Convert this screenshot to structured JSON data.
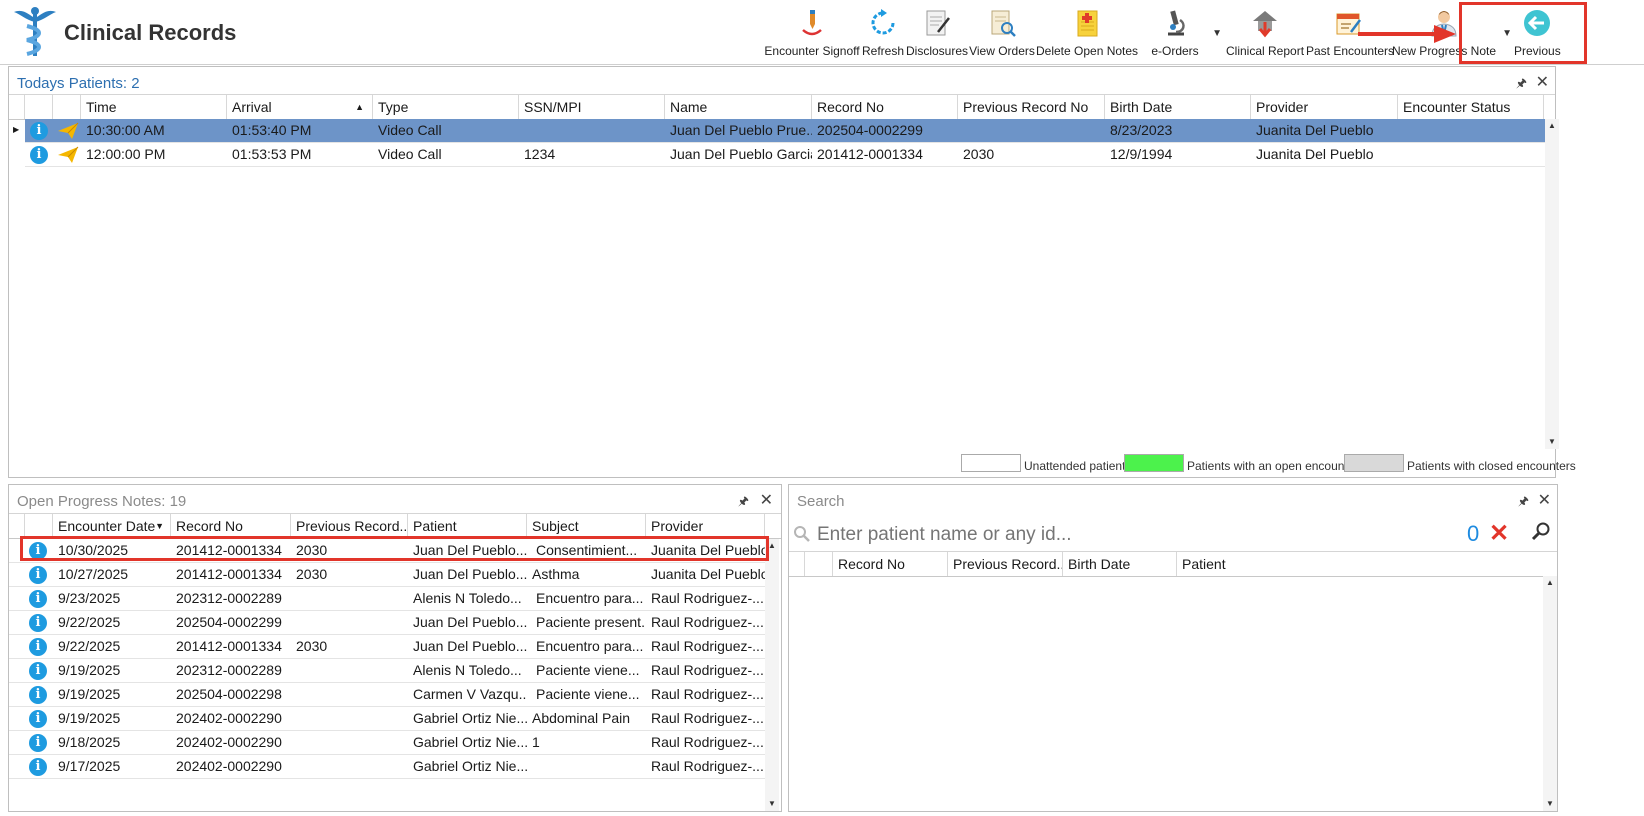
{
  "app": {
    "title": "Clinical Records"
  },
  "toolbar": {
    "encounter_signoff": "Encounter Signoff",
    "refresh": "Refresh",
    "disclosures": "Disclosures",
    "view_orders": "View Orders",
    "delete_open_notes": "Delete Open Notes",
    "e_orders": "e-Orders",
    "clinical_report": "Clinical Report",
    "past_encounters": "Past Encounters",
    "new_progress_note": "New Progress Note",
    "previous": "Previous"
  },
  "todays_patients": {
    "title": "Todays Patients:",
    "count": "2",
    "columns": [
      "Time",
      "Arrival",
      "Type",
      "SSN/MPI",
      "Name",
      "Record No",
      "Previous Record No",
      "Birth Date",
      "Provider",
      "Encounter Status"
    ],
    "rows": [
      {
        "time": "10:30:00 AM",
        "arrival": "01:53:40 PM",
        "type": "Video Call",
        "ssn": "",
        "name": "Juan Del Pueblo Prue...",
        "record_no": "202504-0002299",
        "prev_record_no": "",
        "birth_date": "8/23/2023",
        "provider": "Juanita Del Pueblo",
        "status": ""
      },
      {
        "time": "12:00:00 PM",
        "arrival": "01:53:53 PM",
        "type": "Video Call",
        "ssn": "1234",
        "name": "Juan Del Pueblo Garcia",
        "record_no": "201412-0001334",
        "prev_record_no": "2030",
        "birth_date": "12/9/1994",
        "provider": "Juanita Del Pueblo",
        "status": ""
      }
    ]
  },
  "legend": {
    "unattended": "Unattended patients",
    "open": "Patients with an open encounter",
    "closed": "Patients with closed encounters",
    "colors": {
      "unattended": "#ffffff",
      "open": "#4cf24c",
      "closed": "#d9d9d9"
    }
  },
  "open_notes": {
    "title": "Open Progress Notes:",
    "count": "19",
    "columns": [
      "Encounter Date",
      "Record No",
      "Previous Record...",
      "Patient",
      "Subject",
      "Provider"
    ],
    "rows": [
      {
        "date": "10/30/2025",
        "record_no": "201412-0001334",
        "prev": "2030",
        "patient": "Juan Del Pueblo...",
        "subject": "Consentimient...",
        "provider": "Juanita Del Pueblo"
      },
      {
        "date": "10/27/2025",
        "record_no": "201412-0001334",
        "prev": "2030",
        "patient": "Juan Del Pueblo...",
        "subject": "Asthma",
        "provider": "Juanita Del Pueblo"
      },
      {
        "date": "9/23/2025",
        "record_no": "202312-0002289",
        "prev": "",
        "patient": "Alenis N Toledo...",
        "subject": "Encuentro para...",
        "provider": "Raul Rodriguez-..."
      },
      {
        "date": "9/22/2025",
        "record_no": "202504-0002299",
        "prev": "",
        "patient": "Juan Del Pueblo...",
        "subject": "Paciente present...",
        "provider": "Raul Rodriguez-..."
      },
      {
        "date": "9/22/2025",
        "record_no": "201412-0001334",
        "prev": "2030",
        "patient": "Juan Del Pueblo...",
        "subject": "Encuentro para...",
        "provider": "Raul Rodriguez-..."
      },
      {
        "date": "9/19/2025",
        "record_no": "202312-0002289",
        "prev": "",
        "patient": "Alenis N Toledo...",
        "subject": "Paciente viene...",
        "provider": "Raul Rodriguez-..."
      },
      {
        "date": "9/19/2025",
        "record_no": "202504-0002298",
        "prev": "",
        "patient": "Carmen V Vazqu...",
        "subject": "Paciente viene...",
        "provider": "Raul Rodriguez-..."
      },
      {
        "date": "9/19/2025",
        "record_no": "202402-0002290",
        "prev": "",
        "patient": "Gabriel Ortiz Nie...",
        "subject": "Abdominal Pain",
        "provider": "Raul Rodriguez-..."
      },
      {
        "date": "9/18/2025",
        "record_no": "202402-0002290",
        "prev": "",
        "patient": "Gabriel Ortiz Nie...",
        "subject": "1",
        "provider": "Raul Rodriguez-..."
      },
      {
        "date": "9/17/2025",
        "record_no": "202402-0002290",
        "prev": "",
        "patient": "Gabriel Ortiz Nie...",
        "subject": "",
        "provider": "Raul Rodriguez-..."
      }
    ]
  },
  "search": {
    "title": "Search",
    "placeholder": "Enter patient name or any id...",
    "count": "0",
    "columns": [
      "Record No",
      "Previous Record...",
      "Birth Date",
      "Patient"
    ]
  }
}
